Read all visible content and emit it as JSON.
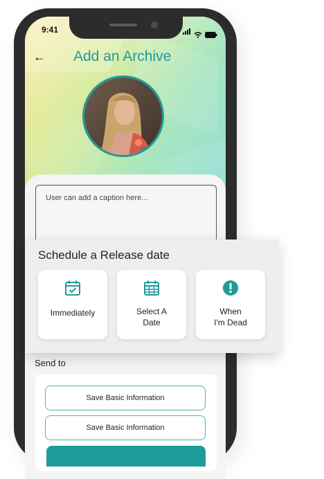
{
  "status_bar": {
    "time": "9:41"
  },
  "header": {
    "title": "Add an Archive",
    "back_icon": "arrow-left-icon"
  },
  "caption": {
    "placeholder": "User can add a caption here..."
  },
  "schedule": {
    "title": "Schedule a Release date",
    "options": [
      {
        "label": "Immediately",
        "icon": "calendar-check-icon"
      },
      {
        "label": "Select A Date",
        "label_lines": [
          "Select A",
          "Date"
        ],
        "icon": "calendar-grid-icon"
      },
      {
        "label": "When I'm Dead",
        "label_lines": [
          "When",
          "I'm Dead"
        ],
        "icon": "alert-circle-icon"
      }
    ]
  },
  "send_to": {
    "label": "Send to",
    "buttons": [
      "Save Basic Information",
      "Save Basic Information"
    ]
  },
  "colors": {
    "accent": "#1f9a9a",
    "outline": "#4cb3b4",
    "phone_frame": "#2c2c2e"
  }
}
